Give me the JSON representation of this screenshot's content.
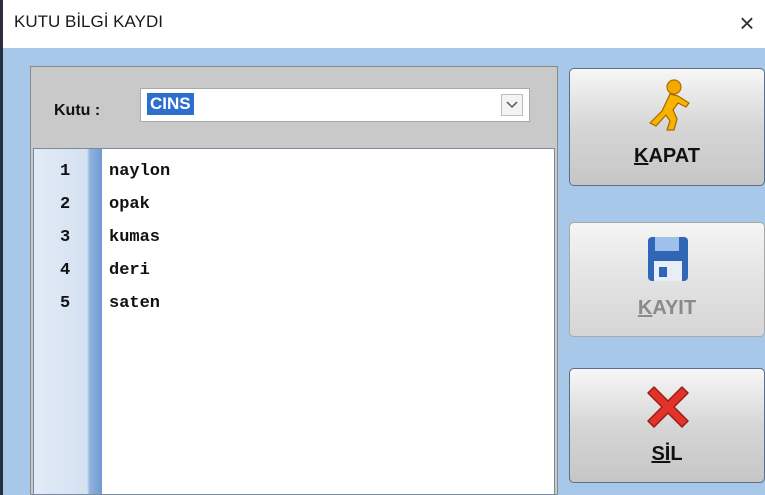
{
  "window": {
    "title": "KUTU BİLGİ KAYDI",
    "close_glyph": "×"
  },
  "kutu": {
    "label": "Kutu :",
    "selected": "CINS"
  },
  "editor": {
    "lines": [
      {
        "num": "1",
        "text": "naylon"
      },
      {
        "num": "2",
        "text": "opak"
      },
      {
        "num": "3",
        "text": "kumas"
      },
      {
        "num": "4",
        "text": "deri"
      },
      {
        "num": "5",
        "text": "saten"
      }
    ]
  },
  "buttons": {
    "kapat": {
      "label_first": "K",
      "label_rest": "APAT",
      "icon": "running-man-icon"
    },
    "kayit": {
      "label_first": "K",
      "label_rest": "AYIT",
      "icon": "floppy-disk-icon",
      "enabled": false
    },
    "sil": {
      "label_first": "Sİ",
      "label_rest": "L",
      "icon": "red-x-icon"
    }
  }
}
